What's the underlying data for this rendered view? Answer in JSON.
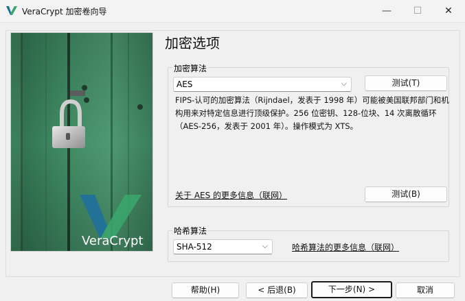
{
  "window": {
    "title": "VeraCrypt 加密卷向导",
    "minimize": "—",
    "maximize": "☐",
    "close": "✕"
  },
  "page": {
    "title": "加密选项",
    "logo_text": "VeraCrypt"
  },
  "encryption": {
    "group_label": "加密算法",
    "selected": "AES",
    "test_button": "测试(T)",
    "description": "FIPS-认可的加密算法（Rijndael，发表于 1998 年）可能被美国联邦部门和机构用来对特定信息进行顶级保护。256 位密钥、128-位块、14 次离散循环（AES-256，发表于 2001 年）。操作模式为 XTS。",
    "more_info_link": "关于 AES 的更多信息（联网）",
    "benchmark_button": "测试(B)"
  },
  "hash": {
    "group_label": "哈希算法",
    "selected": "SHA-512",
    "more_info_link": "哈希算法的更多信息（联网）"
  },
  "footer": {
    "help": "帮助(H)",
    "back": "< 后退(B)",
    "next": "下一步(N) >",
    "cancel": "取消"
  },
  "colors": {
    "door_green": "#3f8a63",
    "logo_blue": "#1f6f9c",
    "logo_green": "#3aa56b"
  }
}
